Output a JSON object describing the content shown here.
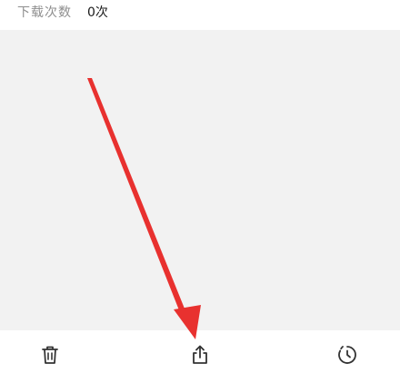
{
  "download_info": {
    "label": "下载次数",
    "value": "0次"
  },
  "toolbar": {
    "items": [
      {
        "icon": "trash-icon"
      },
      {
        "icon": "share-icon"
      },
      {
        "icon": "history-icon"
      }
    ]
  },
  "annotation": {
    "color": "#e8312f",
    "icon": "red-arrow"
  }
}
